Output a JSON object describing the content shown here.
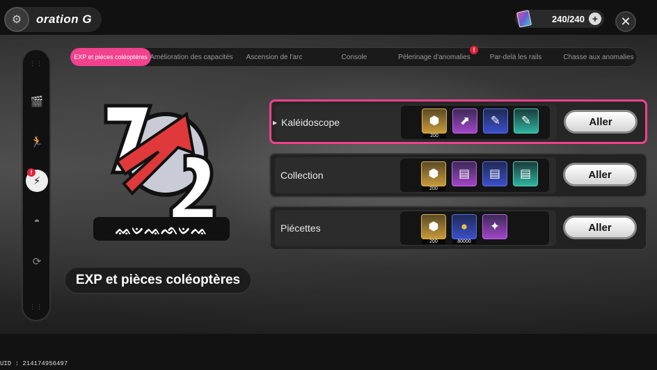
{
  "header": {
    "title": "oration  G",
    "currency_value": "240/240",
    "plus_symbol": "+",
    "close_symbol": "✕"
  },
  "tabs": [
    {
      "label": "EXP et pièces coléoptères",
      "active": true
    },
    {
      "label": "Amélioration des capacités",
      "active": false
    },
    {
      "label": "Ascension de l'arc",
      "active": false
    },
    {
      "label": "Console",
      "active": false
    },
    {
      "label": "Pèlerinage d'anomalies",
      "active": false,
      "alert": true
    },
    {
      "label": "Par-delà les rails",
      "active": false
    },
    {
      "label": "Chasse aux anomalies",
      "active": false
    }
  ],
  "alert_symbol": "!",
  "selected_name": "EXP et pièces coléoptères",
  "emblem_text": "ᨐᨉᨕᨒᨉᨕ",
  "stages": [
    {
      "label": "Kaléidoscope",
      "selected": true,
      "rewards": [
        {
          "icon": "emblem-token-icon",
          "glyph": "⬢",
          "tier": "gold",
          "qty": "200"
        },
        {
          "icon": "arrow-card-icon",
          "glyph": "⬈",
          "tier": "purple",
          "qty": ""
        },
        {
          "icon": "tool-blue-icon",
          "glyph": "✎",
          "tier": "blue",
          "qty": ""
        },
        {
          "icon": "tool-teal-icon",
          "glyph": "✎",
          "tier": "teal",
          "qty": ""
        }
      ],
      "button": "Aller"
    },
    {
      "label": "Collection",
      "selected": false,
      "rewards": [
        {
          "icon": "emblem-token-icon",
          "glyph": "⬢",
          "tier": "gold",
          "qty": "200"
        },
        {
          "icon": "cards-purple-icon",
          "glyph": "▤",
          "tier": "purple",
          "qty": ""
        },
        {
          "icon": "cards-blue-icon",
          "glyph": "▤",
          "tier": "blue",
          "qty": ""
        },
        {
          "icon": "cards-teal-icon",
          "glyph": "▤",
          "tier": "teal",
          "qty": ""
        }
      ],
      "button": "Aller"
    },
    {
      "label": "Piécettes",
      "selected": false,
      "rewards": [
        {
          "icon": "emblem-token-icon",
          "glyph": "⬢",
          "tier": "gold",
          "qty": "200"
        },
        {
          "icon": "coin-icon",
          "glyph": "●",
          "tier": "blue",
          "qty": "80000"
        },
        {
          "icon": "cannon-icon",
          "glyph": "✦",
          "tier": "purple",
          "qty": ""
        }
      ],
      "button": "Aller"
    }
  ],
  "uid": "UID : 214174956497"
}
